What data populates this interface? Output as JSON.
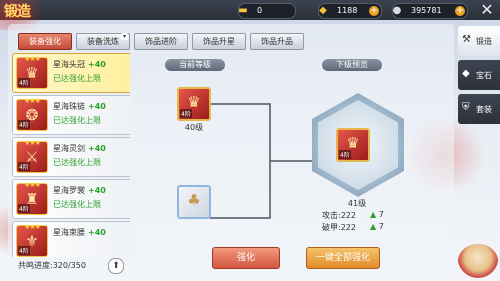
{
  "header": {
    "logo_text": "锻造",
    "gold_value": "0",
    "ingot_value": "1188",
    "silver_value": "395781",
    "close_symbol": "✕"
  },
  "tabs": [
    {
      "label": "装备强化",
      "active": true
    },
    {
      "label": "装备洗炼",
      "active": false
    },
    {
      "label": "饰品进阶",
      "active": false
    },
    {
      "label": "饰品升星",
      "active": false
    },
    {
      "label": "饰品升品",
      "active": false
    }
  ],
  "equipment_list": [
    {
      "name": "星海头冠",
      "bonus": "+40",
      "status": "已达强化上限",
      "stars": "★★★",
      "badge": "4阶",
      "selected": true
    },
    {
      "name": "星海珠链",
      "bonus": "+40",
      "status": "已达强化上限",
      "stars": "★★★",
      "badge": "4阶",
      "selected": false
    },
    {
      "name": "星海灵剑",
      "bonus": "+40",
      "status": "已达强化上限",
      "stars": "★★★",
      "badge": "4阶",
      "selected": false
    },
    {
      "name": "星海罗裳",
      "bonus": "+40",
      "status": "已达强化上限",
      "stars": "★★★",
      "badge": "4阶",
      "selected": false
    },
    {
      "name": "星海束腰",
      "bonus": "+40",
      "status": "",
      "stars": "★★★",
      "badge": "4阶",
      "selected": false
    }
  ],
  "progress_text": "共鸣进度:320/350",
  "current_level_header": "当前等级",
  "next_preview_header": "下级预览",
  "current_item": {
    "badge": "4阶",
    "level": "40级"
  },
  "next_item": {
    "badge": "4阶",
    "level": "41级"
  },
  "stats": [
    {
      "label": "攻击:222",
      "increase": "7"
    },
    {
      "label": "破甲:222",
      "increase": "7"
    }
  ],
  "buttons": {
    "enhance": "强化",
    "enhance_all": "一键全部强化"
  },
  "side_tabs": [
    {
      "label": "锻造",
      "icon": "anvil-icon",
      "active": true
    },
    {
      "label": "宝石",
      "icon": "gem-icon",
      "active": false
    },
    {
      "label": "套装",
      "icon": "armor-icon",
      "active": false
    }
  ]
}
